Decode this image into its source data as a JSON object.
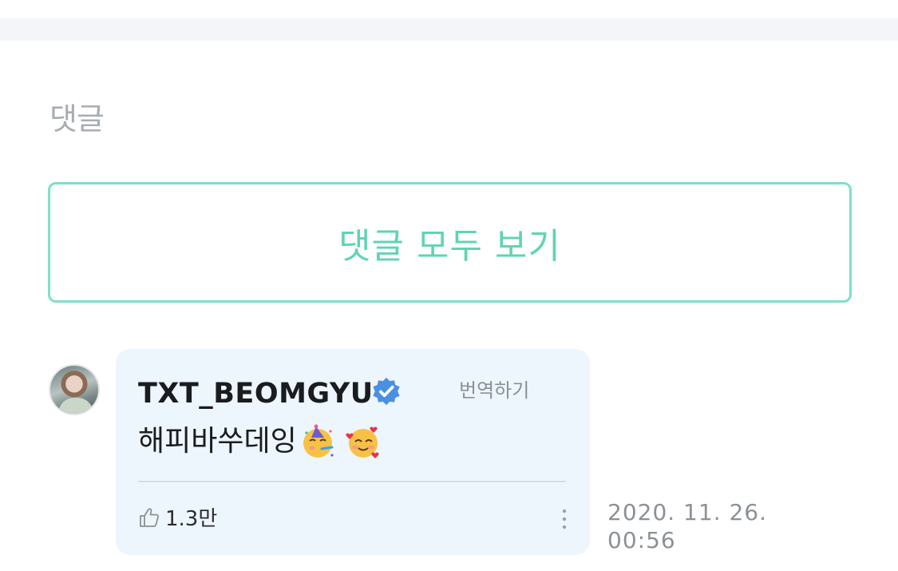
{
  "section": {
    "title": "댓글"
  },
  "view_all": {
    "label": "댓글 모두 보기"
  },
  "comment": {
    "author": "TXT_BEOMGYU",
    "verified": true,
    "translate_label": "번역하기",
    "text": "해피바쑤데잉",
    "emojis": [
      "partying-face-emoji",
      "smiling-face-with-hearts-emoji"
    ],
    "likes": "1.3만",
    "timestamp_date": "2020. 11. 26.",
    "timestamp_time": "00:56"
  },
  "colors": {
    "accent": "#5fd4b5",
    "accent_border": "#7ee0c7",
    "bubble_bg": "#eef6fd",
    "verified": "#4a90e2",
    "muted_text": "#8c9197"
  }
}
